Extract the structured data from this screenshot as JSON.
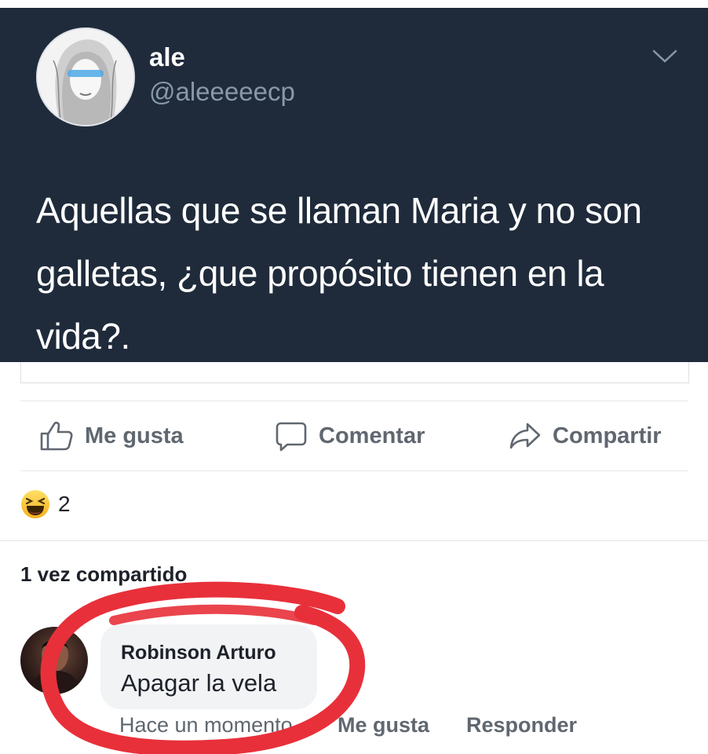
{
  "tweet": {
    "name": "ale",
    "handle": "@aleeeeecp",
    "text": "Aquellas que se llaman Maria y no son galletas, ¿que propósito tienen en la vida?."
  },
  "actions": {
    "like_label": "Me gusta",
    "comment_label": "Comentar",
    "share_label": "Compartir"
  },
  "reactions": {
    "count": "2",
    "icon": "haha-emoji-icon"
  },
  "shares": {
    "text": "1 vez compartido"
  },
  "comment": {
    "author": "Robinson Arturo",
    "text": "Apagar la vela",
    "time": "Hace un momento",
    "like_label": "Me gusta",
    "reply_label": "Responder"
  },
  "colors": {
    "tweet_bg": "#1f2b3b",
    "handle": "#8899a6",
    "action_text": "#606770",
    "annotation_red": "#e8303a"
  }
}
